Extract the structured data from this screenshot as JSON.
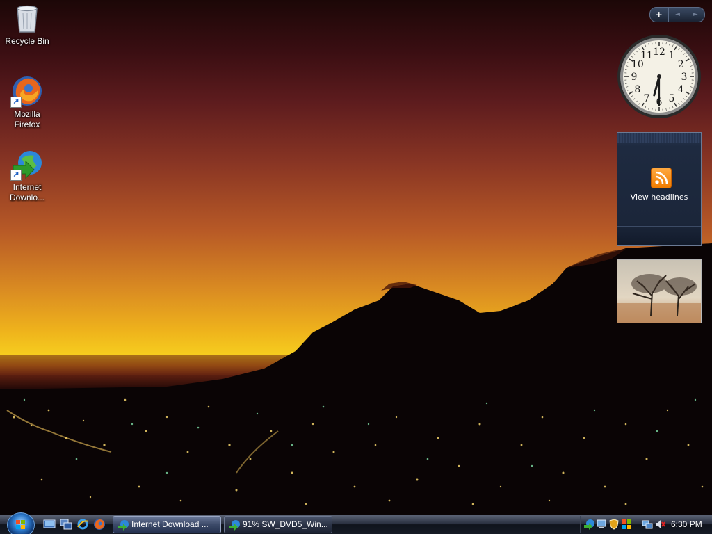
{
  "desktop": {
    "icons": [
      {
        "label": "Recycle Bin",
        "icon": "recycle-bin-icon"
      },
      {
        "label": "Mozilla Firefox",
        "icon": "firefox-icon"
      },
      {
        "label": "Internet Downlo...",
        "icon": "internet-download-manager-icon"
      }
    ]
  },
  "sidebar": {
    "controls": {
      "add": "+",
      "prev": "◄",
      "next": "►"
    },
    "clock": {
      "hour": 6,
      "minute": 30,
      "numerals": [
        "12",
        "1",
        "2",
        "3",
        "4",
        "5",
        "6",
        "7",
        "8",
        "9",
        "10",
        "11"
      ]
    },
    "feed_headlines": {
      "label": "View headlines",
      "icon": "rss-feed-icon"
    },
    "slideshow": {
      "icon": "slideshow-tree-image"
    }
  },
  "taskbar": {
    "start_icon": "windows-start-orb",
    "quick_launch": [
      {
        "icon": "show-desktop-icon"
      },
      {
        "icon": "switch-windows-icon"
      },
      {
        "icon": "internet-explorer-icon"
      },
      {
        "icon": "firefox-icon"
      }
    ],
    "tasks": [
      {
        "label": "Internet Download ...",
        "icon": "internet-download-manager-icon",
        "active": true
      },
      {
        "label": "91% SW_DVD5_Win...",
        "icon": "internet-download-manager-icon",
        "active": false
      }
    ],
    "tray": {
      "icons": [
        "idm-tray-icon",
        "network-monitor-icon",
        "security-shield-icon",
        "windows-update-icon",
        "network-connection-icon",
        "volume-muted-icon"
      ],
      "time": "6:30 PM"
    }
  }
}
